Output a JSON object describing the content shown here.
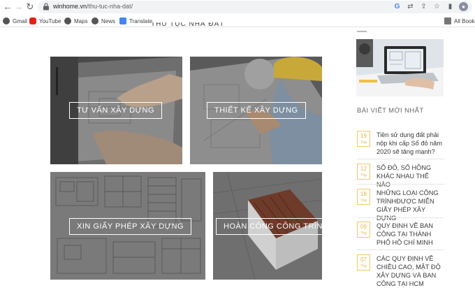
{
  "browser": {
    "url_host": "winhome.vn",
    "url_path": "/thu-tuc-nha-dat/",
    "bookmarks": [
      "Gmail",
      "YouTube",
      "Maps",
      "News",
      "Translate"
    ],
    "all_bookmarks": "All Bookm"
  },
  "page": {
    "title_fragment": "THỦ TỤC NHÀ ĐẤT"
  },
  "services": [
    {
      "label": "TƯ VẤN XÂY DỰNG"
    },
    {
      "label": "THIẾT KẾ XÂY DỰNG"
    },
    {
      "label": "XIN GIẤY PHÉP XÂY DỰNG"
    },
    {
      "label": "HOÀN CÔNG CÔNG TRÌNH"
    }
  ],
  "sidebar": {
    "heading": "BÀI VIẾT MỚI NHẤT",
    "posts": [
      {
        "day": "19",
        "month": "Thg",
        "title": "Tiền sử dụng đất phải nộp khi cấp Sổ đỏ năm 2020 sẽ tăng mạnh?"
      },
      {
        "day": "12",
        "month": "Thg",
        "title": "SỔ ĐỎ, SỔ HỒNG KHÁC NHAU THẾ NÀO"
      },
      {
        "day": "18",
        "month": "Thg",
        "title": "NHỮNG LOẠI CÔNG TRÌNHĐƯỢC MIỄN GIẤY PHÉP XÂY DỰNG"
      },
      {
        "day": "09",
        "month": "Thg",
        "title": "QUY ĐỊNH VỀ BAN CÔNG TẠI THÀNH PHỐ HỒ CHÍ MINH"
      },
      {
        "day": "07",
        "month": "Thg",
        "title": "CÁC QUY ĐỊNH VỀ CHIỀU CAO, MẬT ĐỘ XÂY DỰNG VÀ BAN CÔNG TẠI HCM"
      }
    ]
  },
  "colors": {
    "accent_date": "#e8b24a",
    "tile_overlay": "#3a3a3a"
  }
}
